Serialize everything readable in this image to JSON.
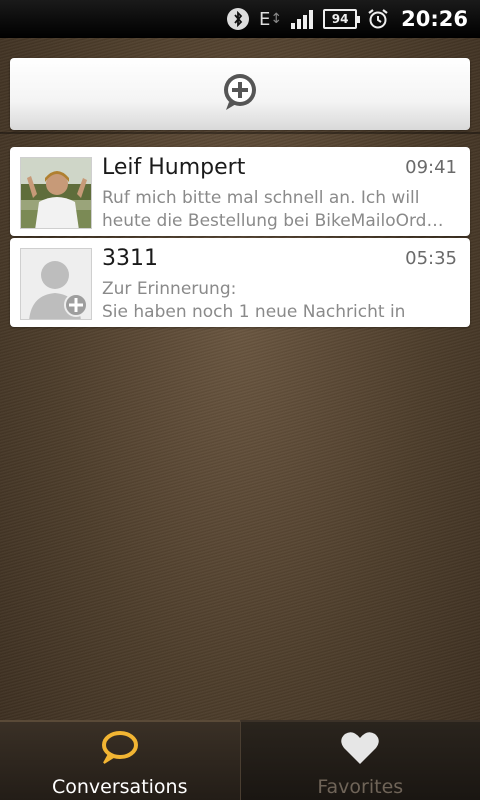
{
  "status_bar": {
    "network_type": "E",
    "battery_level": "94",
    "time": "20:26",
    "icons": [
      "bluetooth-icon",
      "data-arrows-icon",
      "signal-icon",
      "battery-icon",
      "alarm-icon"
    ]
  },
  "compose": {
    "icon": "new-message-plus-bubble-icon"
  },
  "conversations": [
    {
      "name": "Leif Humpert",
      "time": "09:41",
      "preview_line1": "Ruf mich bitte mal schnell an. Ich will",
      "preview_line2": "heute die Bestellung bei BikeMailoOrd…",
      "avatar": "contact-photo"
    },
    {
      "name": "3311",
      "time": "05:35",
      "preview_line1": "Zur Erinnerung:",
      "preview_line2": "Sie haben noch 1 neue Nachricht in",
      "avatar": "unknown-contact-add-icon"
    }
  ],
  "tabs": [
    {
      "label": "Conversations",
      "icon": "speech-bubble-icon",
      "active": true,
      "color": "#f2b533"
    },
    {
      "label": "Favorites",
      "icon": "heart-icon",
      "active": false,
      "color": "#e6e6e6"
    }
  ]
}
